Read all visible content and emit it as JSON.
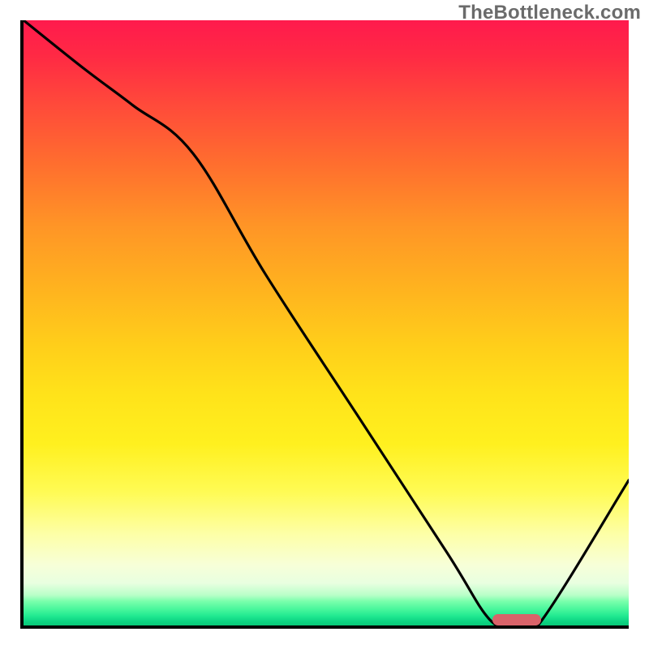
{
  "watermark": "TheBottleneck.com",
  "chart_data": {
    "type": "line",
    "title": "",
    "xlabel": "",
    "ylabel": "",
    "xlim": [
      0,
      100
    ],
    "ylim": [
      0,
      100
    ],
    "grid": false,
    "legend": false,
    "series": [
      {
        "name": "bottleneck-curve",
        "x": [
          0,
          10,
          18,
          28,
          40,
          55,
          70,
          77,
          81,
          85,
          100
        ],
        "values": [
          100,
          92,
          86,
          78,
          58,
          35,
          12,
          1,
          0,
          0,
          24
        ]
      }
    ],
    "annotations": [
      {
        "name": "optimal-zone",
        "x_start": 77,
        "x_end": 85,
        "y": 0,
        "color": "#d9636a"
      }
    ],
    "background_gradient": {
      "direction": "vertical",
      "stops": [
        {
          "pos": 0.0,
          "color": "#ff1a4d"
        },
        {
          "pos": 0.5,
          "color": "#ffcf1a"
        },
        {
          "pos": 0.85,
          "color": "#fdffa8"
        },
        {
          "pos": 0.97,
          "color": "#42f59a"
        },
        {
          "pos": 1.0,
          "color": "#07c878"
        }
      ]
    }
  }
}
